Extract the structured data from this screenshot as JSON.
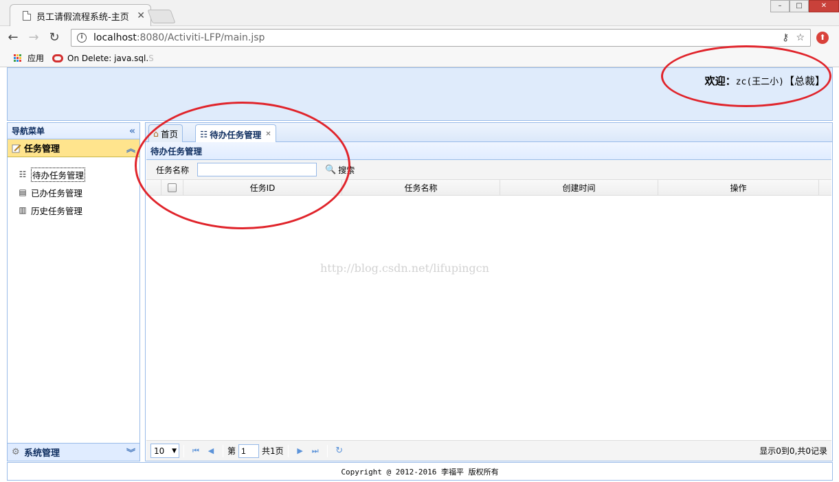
{
  "browser": {
    "tab_title": "员工请假流程系统-主页",
    "url_host": "localhost",
    "url_rest": ":8080/Activiti-LFP/main.jsp",
    "bookmarks": [
      {
        "label": "应用",
        "icon": "apps-icon"
      },
      {
        "label": "On Delete: java.sql.",
        "icon": "oracle-icon",
        "fade": "S"
      }
    ]
  },
  "header": {
    "welcome_label": "欢迎：",
    "user": "zc(王二小)",
    "role": "【总裁】"
  },
  "sidebar": {
    "title": "导航菜单",
    "accordions": [
      {
        "title": "任务管理",
        "items": [
          {
            "label": "待办任务管理",
            "icon": "todo-list-icon"
          },
          {
            "label": "已办任务管理",
            "icon": "done-list-icon"
          },
          {
            "label": "历史任务管理",
            "icon": "history-icon"
          }
        ]
      },
      {
        "title": "系统管理",
        "icon": "gear-icon"
      }
    ]
  },
  "main": {
    "tabs": [
      {
        "label": "首页",
        "icon": "home-icon"
      },
      {
        "label": "待办任务管理",
        "icon": "todo-list-icon"
      }
    ],
    "panel_title": "待办任务管理",
    "search": {
      "label": "任务名称",
      "value": "",
      "button": "搜索"
    },
    "columns": [
      "任务ID",
      "任务名称",
      "创建时间",
      "操作"
    ],
    "rows": [],
    "watermark": "http://blog.csdn.net/lifupingcn",
    "pager": {
      "page_size": "10",
      "page_prefix": "第",
      "page_value": "1",
      "page_total": "共1页",
      "info": "显示0到0,共0记录"
    }
  },
  "footer": {
    "text": "Copyright @ 2012-2016 李福平 版权所有"
  },
  "colors": {
    "annotation": "#e0242b",
    "panel_border": "#99bbe8",
    "active_accordion": "#ffe48d"
  }
}
